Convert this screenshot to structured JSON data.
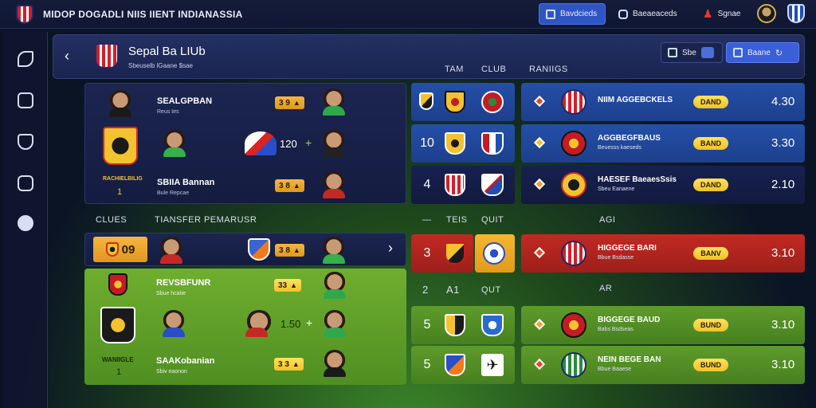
{
  "topbar": {
    "title": "MIDOP DOGADLI NIIS  IIENT  INDIANASSIA",
    "btn_primary": "Bavdcieds",
    "btn_secondary": "Baeaeaceds",
    "btn_user": "Sgnae"
  },
  "header": {
    "club_name": "Sepal Ba LIUb",
    "club_sub": "Sbeuselb lGaane  $sae",
    "col_team": "TAM",
    "col_club": "CLUB",
    "col_rankings": "RANIIGS",
    "action_btn": "Sbe",
    "primary_btn": "Baane"
  },
  "squad": {
    "rows": [
      {
        "name": "SEALGPBAN",
        "sub": "Reus tes",
        "chip": "3 9"
      },
      {
        "name": "",
        "sub": "",
        "chip": "120"
      },
      {
        "name": "SBIIA Bannan",
        "sub": "Bule Repcae",
        "chip": "3 8"
      }
    ],
    "club_label": "RACHIELBILIG",
    "club_num": "1"
  },
  "transfer": {
    "label_clubs": "CLUES",
    "label_transfer": "TIANSFER PEMARUSR",
    "featured_chip": "09",
    "row1_chip": "3 8",
    "rows": [
      {
        "name": "REVSBFUNR",
        "sub": "Sbue hcatie",
        "chip": "33"
      },
      {
        "name": "",
        "sub": "",
        "chip": "1.50"
      },
      {
        "name": "SAAKobanian",
        "sub": "Sbiv eaonon",
        "chip": "3 3"
      }
    ],
    "club_label": "WANIIGLE",
    "club_num": "1"
  },
  "mid": {
    "head_a": "—",
    "head_b": "TEIS",
    "head_c": "QUIT",
    "head2_a": "2",
    "head2_b": "A1",
    "head2_c": "QUT",
    "tiles": [
      "10",
      "4",
      "3",
      "5",
      "5"
    ]
  },
  "rankings": {
    "agt_label": "AGI",
    "ar_label": "AR",
    "rows": [
      {
        "name": "NIIM AGGEBCKELS",
        "sub": "",
        "pill": "DAND",
        "score": "4.30"
      },
      {
        "name": "AGGBEGFBAUS",
        "sub": "Beuesss kaeseds",
        "pill": "BAND",
        "score": "3.30"
      },
      {
        "name": "HAESEF BaeaesSsis",
        "sub": "Sbeu Eanaene",
        "pill": "DAND",
        "score": "2.10"
      },
      {
        "name": "HIGGEGE BARI",
        "sub": "Bbue Bsdasse",
        "pill": "BANV",
        "score": "3.10"
      },
      {
        "name": "BIGGEGE BAUD",
        "sub": "Babs Bsdseas",
        "pill": "BUND",
        "score": "3.10"
      },
      {
        "name": "NEIN BEGE BAN",
        "sub": "Bbue Baaese",
        "pill": "BUND",
        "score": "3.10"
      }
    ]
  }
}
